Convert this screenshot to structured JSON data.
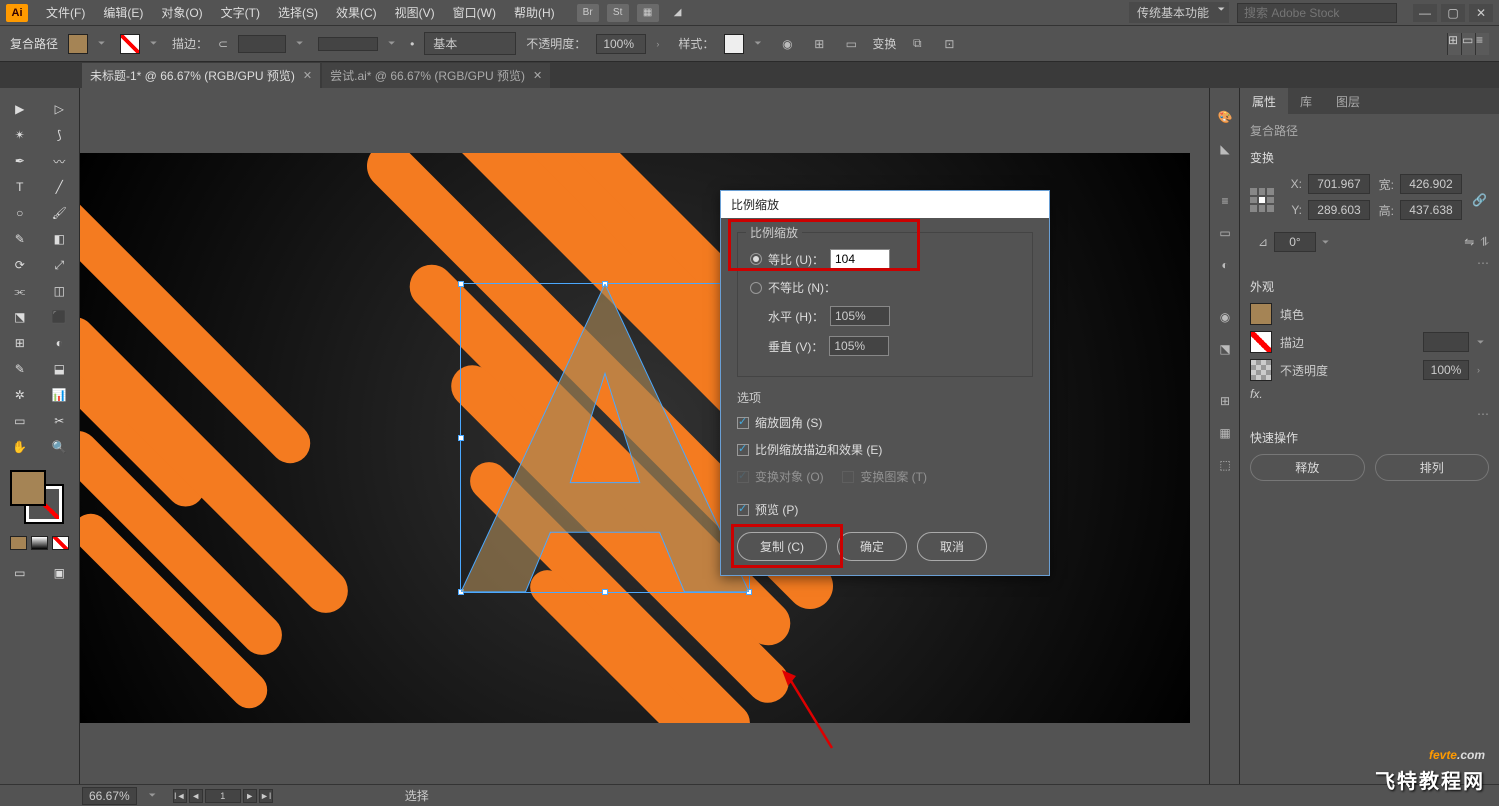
{
  "menu": [
    "文件(F)",
    "编辑(E)",
    "对象(O)",
    "文字(T)",
    "选择(S)",
    "效果(C)",
    "视图(V)",
    "窗口(W)",
    "帮助(H)"
  ],
  "workspace": "传统基本功能",
  "search_placeholder": "搜索 Adobe Stock",
  "control": {
    "selection": "复合路径",
    "stroke_label": "描边：",
    "stroke_width": "",
    "profile": "基本",
    "opacity_label": "不透明度：",
    "opacity": "100%",
    "style_label": "样式：",
    "transform_label": "变换"
  },
  "tabs": [
    {
      "label": "未标题-1* @ 66.67% (RGB/GPU 预览)",
      "active": true
    },
    {
      "label": "尝试.ai* @ 66.67% (RGB/GPU 预览)",
      "active": false
    }
  ],
  "dialog": {
    "title": "比例缩放",
    "section_scale": "比例缩放",
    "uniform": "等比 (U)：",
    "uniform_val": "104",
    "nonuniform": "不等比 (N)：",
    "horiz": "水平 (H)：",
    "horiz_val": "105%",
    "vert": "垂直 (V)：",
    "vert_val": "105%",
    "options": "选项",
    "scale_corners": "缩放圆角 (S)",
    "scale_strokes": "比例缩放描边和效果 (E)",
    "transform_obj": "变换对象 (O)",
    "transform_pat": "变换图案 (T)",
    "preview": "预览 (P)",
    "copy": "复制 (C)",
    "ok": "确定",
    "cancel": "取消"
  },
  "panel": {
    "tabs": [
      "属性",
      "库",
      "图层"
    ],
    "obj_type": "复合路径",
    "transform": "变换",
    "x": "701.967",
    "y": "289.603",
    "w": "426.902",
    "h": "437.638",
    "rotate": "0°",
    "appearance": "外观",
    "fill": "填色",
    "stroke": "描边",
    "opacity_label": "不透明度",
    "opacity": "100%",
    "fx": "fx.",
    "quick": "快速操作",
    "release": "释放",
    "arrange": "排列"
  },
  "status": {
    "zoom": "66.67%",
    "page": "1",
    "mode": "选择"
  },
  "watermark": {
    "line1a": "fevte",
    "line1b": ".com",
    "line2": "飞特教程网"
  }
}
